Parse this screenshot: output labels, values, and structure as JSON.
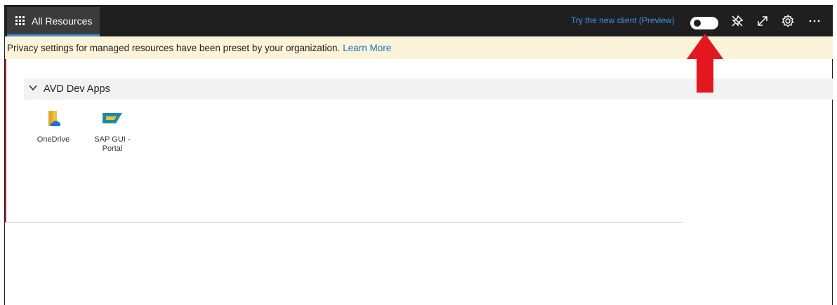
{
  "topbar": {
    "tab_label": "All Resources",
    "try_new_client": "Try the new client (Preview)",
    "toggle_state": "off",
    "icons": [
      "pin-off-icon",
      "expand-icon",
      "gear-icon",
      "more-icon"
    ]
  },
  "banner": {
    "text": "Privacy settings for managed resources have been preset by your organization.",
    "link": "Learn More"
  },
  "group": {
    "name": "AVD Dev Apps",
    "apps": [
      {
        "label": "OneDrive",
        "icon": "onedrive-icon"
      },
      {
        "label": "SAP GUI - Portal",
        "icon": "sap-gui-icon"
      }
    ]
  },
  "colors": {
    "topbar_bg": "#1f1f1f",
    "link": "#3f93e8",
    "banner_bg": "#fbf4d9",
    "annotation_arrow": "#e4161f"
  }
}
